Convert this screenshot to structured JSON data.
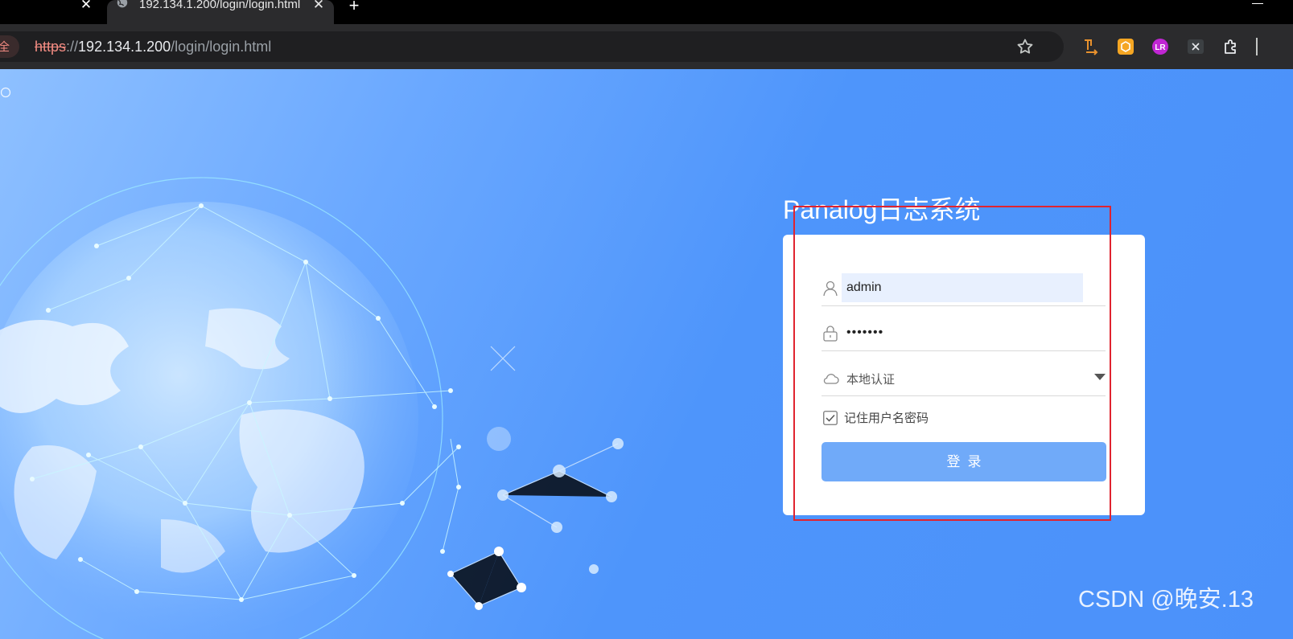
{
  "browser": {
    "active_tab": {
      "title": "192.134.1.200/login/login.html",
      "close_glyph": "✕",
      "favicon": "globe-icon"
    },
    "prev_tab_close_glyph": "✕",
    "new_tab_glyph": "+",
    "address_bar": {
      "security_label": "安全",
      "url_scheme": "https",
      "url_separator": "://",
      "url_host": "192.134.1.200",
      "url_path": "/login/login.html"
    },
    "bookmark_icon": "star-icon",
    "extensions": [
      "bookmark-arrow-extension-icon",
      "hexagon-extension-icon",
      "lr-extension-icon",
      "x-extension-icon",
      "puzzle-extensions-icon"
    ]
  },
  "login": {
    "title": "Panalog日志系统",
    "username_value": "admin",
    "password_value": "•••••••",
    "auth_method": "本地认证",
    "remember_label": "记住用户名密码",
    "remember_checked": true,
    "submit_label": "登录"
  },
  "watermark": "CSDN @晚安.13",
  "colors": {
    "background_blue": "#4e95fb",
    "button_blue": "#70aaf9",
    "annotation_red": "#e0232f",
    "autofill_bg": "#e8f0fe"
  }
}
